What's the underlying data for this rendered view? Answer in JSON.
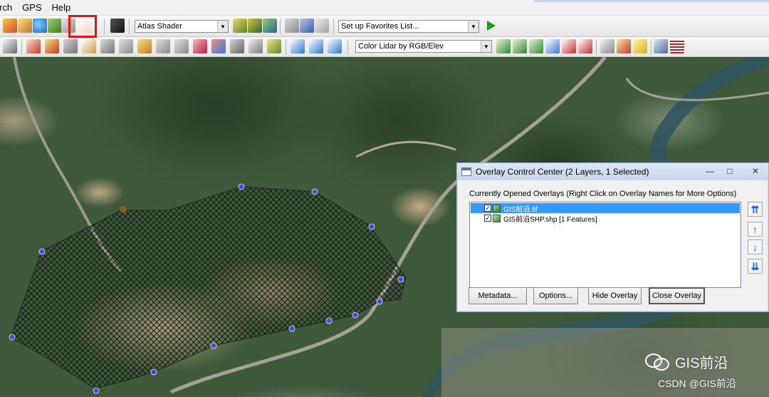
{
  "menu": {
    "items": [
      "rch",
      "GPS",
      "Help"
    ]
  },
  "toolbar1": {
    "shader_select": "Atlas Shader",
    "favorites_select": "Set up Favorites List...",
    "run_icon": "play-icon"
  },
  "toolbar2": {
    "lidar_select": "Color Lidar by RGB/Elev"
  },
  "overlay_window": {
    "title": "Overlay Control Center (2 Layers, 1 Selected)",
    "minimize": "—",
    "maximize": "□",
    "close": "✕",
    "list_label": "Currently Opened Overlays (Right Click on Overlay Names for More Options)",
    "layers": [
      {
        "name": "GIS前沿.tif",
        "checked": true,
        "selected": true
      },
      {
        "name": "GIS前沿SHP.shp [1 Features]",
        "checked": true,
        "selected": false
      }
    ],
    "move_buttons": [
      "move-top-icon",
      "move-up-icon",
      "move-down-icon",
      "move-bottom-icon"
    ],
    "buttons": {
      "metadata": "Metadata...",
      "options": "Options...",
      "hide": "Hide Overlay",
      "close": "Close Overlay"
    }
  },
  "watermark": {
    "title": "GIS前沿",
    "source": "CSDN @GIS前沿"
  },
  "colors": {
    "highlight_box": "#e01414",
    "selected_row": "#3399ff",
    "vertex": "#4a4ad8",
    "accent_blue": "#1b5fd1"
  }
}
